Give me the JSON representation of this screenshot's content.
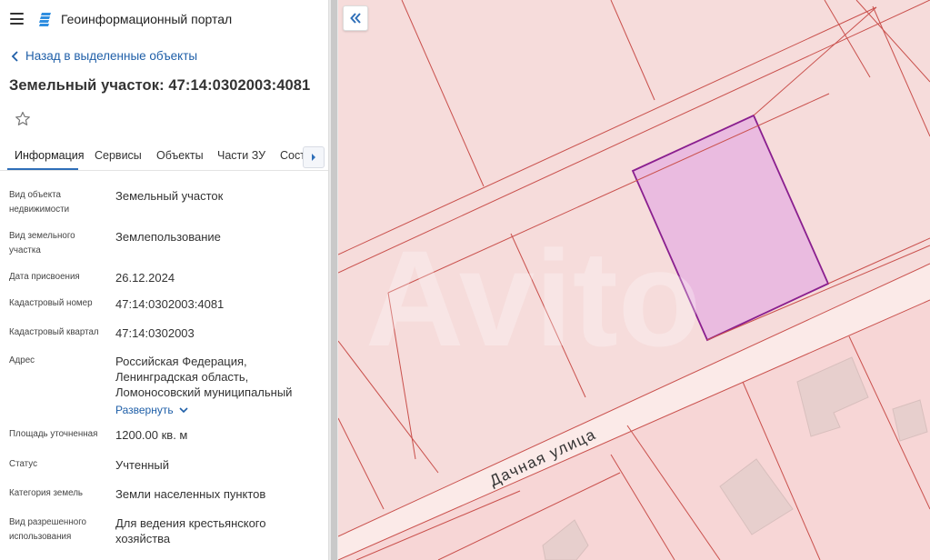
{
  "header": {
    "app_title": "Геоинформационный портал",
    "menu_icon": "menu-icon",
    "logo_icon": "layers-logo-icon"
  },
  "back_link": {
    "label": "Назад в выделенные объекты",
    "icon": "chevron-left-icon"
  },
  "object": {
    "title": "Земельный участок: 47:14:0302003:4081",
    "favorite_icon": "star-outline-icon"
  },
  "tabs": [
    {
      "label": "Информация",
      "active": true
    },
    {
      "label": "Сервисы",
      "active": false
    },
    {
      "label": "Объекты",
      "active": false
    },
    {
      "label": "Части ЗУ",
      "active": false
    },
    {
      "label": "Соста",
      "active": false
    }
  ],
  "tabs_scroll_icon": "chevron-right-icon",
  "properties": [
    {
      "label": "Вид объекта недвижимости",
      "value": "Земельный участок"
    },
    {
      "label": "Вид земельного участка",
      "value": "Землепользование"
    },
    {
      "label": "Дата присвоения",
      "value": "26.12.2024"
    },
    {
      "label": "Кадастровый номер",
      "value": "47:14:0302003:4081"
    },
    {
      "label": "Кадастровый квартал",
      "value": "47:14:0302003"
    },
    {
      "label": "Адрес",
      "value": "Российская Федерация, Ленинградская область, Ломоносовский муниципальный"
    },
    {
      "label": "Площадь уточненная",
      "value": "1200.00 кв. м"
    },
    {
      "label": "Статус",
      "value": "Учтенный"
    },
    {
      "label": "Категория земель",
      "value": "Земли населенных пунктов"
    },
    {
      "label": "Вид разрешенного использования",
      "value": "Для ведения крестьянского хозяйства"
    }
  ],
  "address_expand": {
    "label": "Развернуть",
    "icon": "chevron-down-icon"
  },
  "map": {
    "street_label": "Дачная улица",
    "collapse_icon": "double-chevron-left-icon",
    "watermark": "Avito",
    "colors": {
      "parcel_fill": "#f6dcdb",
      "parcel_line": "#c9504c",
      "selected_fill": "#e8b5e0",
      "selected_line": "#8a1f8f",
      "road": "#fbeae8",
      "building": "#e8d4d2"
    }
  }
}
